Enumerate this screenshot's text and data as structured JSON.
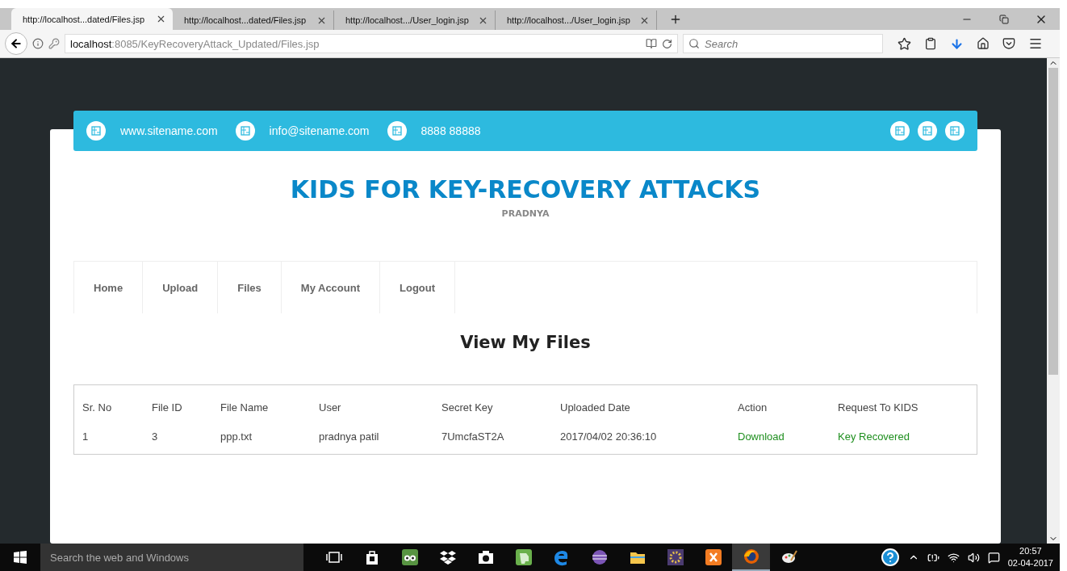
{
  "browser": {
    "tabs": [
      {
        "title": "http://localhost...dated/Files.jsp",
        "selected": true
      },
      {
        "title": "http://localhost...dated/Files.jsp",
        "selected": false
      },
      {
        "title": "http://localhost.../User_login.jsp",
        "selected": false
      },
      {
        "title": "http://localhost.../User_login.jsp",
        "selected": false
      }
    ],
    "address": {
      "host": "localhost",
      "rest": ":8085/KeyRecoveryAttack_Updated/Files.jsp"
    },
    "search": {
      "placeholder": "Search"
    }
  },
  "topbar": {
    "contacts": [
      "www.sitename.com",
      "info@sitename.com",
      "8888 88888"
    ]
  },
  "header": {
    "title": "KIDS FOR KEY-RECOVERY ATTACKS",
    "subtitle": "PRADNYA"
  },
  "nav": [
    "Home",
    "Upload",
    "Files",
    "My Account",
    "Logout"
  ],
  "section_title": "View My Files",
  "table": {
    "columns": [
      {
        "label": "Sr. No",
        "kind": "text"
      },
      {
        "label": "File ID",
        "kind": "text"
      },
      {
        "label": "File Name",
        "kind": "text"
      },
      {
        "label": "User",
        "kind": "text"
      },
      {
        "label": "Secret Key",
        "kind": "text"
      },
      {
        "label": "Uploaded Date",
        "kind": "text"
      },
      {
        "label": "Action",
        "kind": "link"
      },
      {
        "label": "Request To KIDS",
        "kind": "link"
      }
    ],
    "rows": [
      [
        "1",
        "3",
        "ppp.txt",
        "pradnya patil",
        "7UmcfaST2A",
        "2017/04/02 20:36:10",
        "Download",
        "Key Recovered"
      ]
    ]
  },
  "taskbar": {
    "search": {
      "placeholder": "Search the web and Windows"
    },
    "apps": [
      {
        "kind": "taskview",
        "selected": false
      },
      {
        "kind": "store",
        "selected": false
      },
      {
        "kind": "owl",
        "selected": false
      },
      {
        "kind": "dropbox",
        "selected": false
      },
      {
        "kind": "camera",
        "selected": false
      },
      {
        "kind": "elephant",
        "selected": false
      },
      {
        "kind": "edge",
        "selected": false
      },
      {
        "kind": "eclipse",
        "selected": false
      },
      {
        "kind": "folder",
        "selected": false
      },
      {
        "kind": "gear",
        "selected": false
      },
      {
        "kind": "xampp",
        "selected": false
      },
      {
        "kind": "firefox",
        "selected": true
      },
      {
        "kind": "paint",
        "selected": false
      }
    ],
    "time": "20:57",
    "date": "02-04-2017"
  }
}
